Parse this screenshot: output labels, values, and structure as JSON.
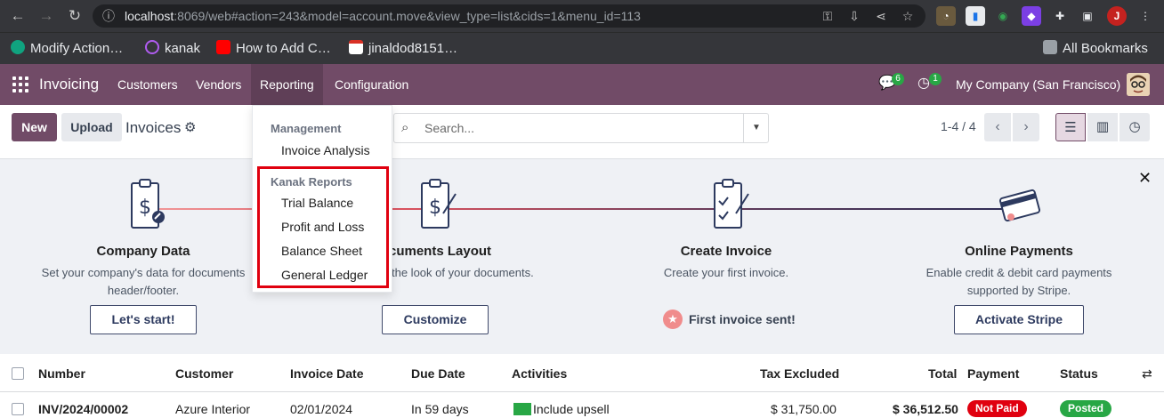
{
  "browser": {
    "url_host": "localhost",
    "url_path": ":8069/web#action=243&model=account.move&view_type=list&cids=1&menu_id=113",
    "profile_initial": "J",
    "bookmarks": [
      "Modify Action…",
      "kanak",
      "How to Add C…",
      "jinaldod8151…"
    ],
    "all_bookmarks": "All Bookmarks"
  },
  "navbar": {
    "app_name": "Invoicing",
    "menus": [
      "Customers",
      "Vendors",
      "Reporting",
      "Configuration"
    ],
    "messages_count": "6",
    "activities_count": "1",
    "company": "My Company (San Francisco)"
  },
  "control_panel": {
    "new_label": "New",
    "upload_label": "Upload",
    "title": "Invoices",
    "search_placeholder": "Search...",
    "pager": "1-4 / 4"
  },
  "reporting_menu": {
    "section1": "Management",
    "section1_items": [
      "Invoice Analysis"
    ],
    "section2": "Kanak Reports",
    "section2_items": [
      "Trial Balance",
      "Profit and Loss",
      "Balance Sheet",
      "General Ledger"
    ]
  },
  "onboarding": {
    "steps": [
      {
        "title": "Company Data",
        "desc1": "Set your company's data for documents",
        "desc2": "header/footer.",
        "button": "Let's start!"
      },
      {
        "title": "cuments Layout",
        "desc1": "the look of your documents.",
        "button": "Customize"
      },
      {
        "title": "Create Invoice",
        "desc1": "Create your first invoice.",
        "done": "First invoice sent!"
      },
      {
        "title": "Online Payments",
        "desc1": "Enable credit & debit card payments",
        "desc2": "supported by Stripe.",
        "button": "Activate Stripe"
      }
    ]
  },
  "table": {
    "columns": [
      "Number",
      "Customer",
      "Invoice Date",
      "Due Date",
      "Activities",
      "Tax Excluded",
      "Total",
      "Payment",
      "Status"
    ],
    "rows": [
      {
        "number": "INV/2024/00002",
        "customer": "Azure Interior",
        "invoice_date": "02/01/2024",
        "due_date": "In 59 days",
        "activity": "Include upsell",
        "tax_excluded": "$ 31,750.00",
        "total": "$ 36,512.50",
        "payment": "Not Paid",
        "status": "Posted"
      }
    ]
  },
  "colors": {
    "brand": "#714b67",
    "highlight": "#e0000f",
    "not_paid": "#e0000f",
    "posted": "#28a745"
  }
}
